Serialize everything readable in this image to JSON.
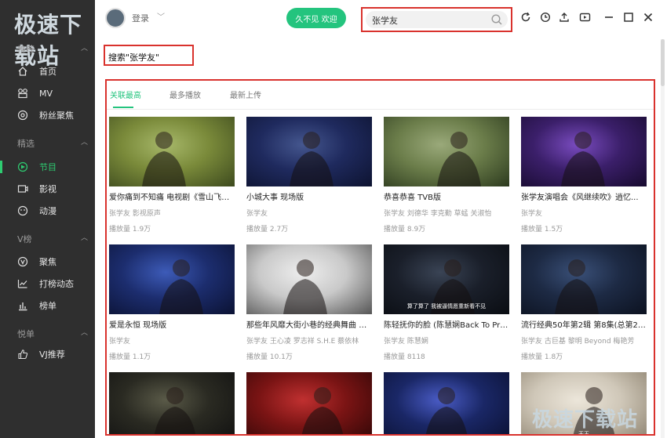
{
  "brand": {
    "watermark_top": "极速下载站",
    "watermark_bottom": "极速下载站"
  },
  "header": {
    "login_label": "登录",
    "promo_label": "久不见 欢迎",
    "search_value": "张学友",
    "accent": "#24c47e",
    "highlight": "#d9322d"
  },
  "sidebar": {
    "sections": [
      {
        "title": "推荐",
        "items": [
          "首页",
          "MV",
          "粉丝聚焦"
        ]
      },
      {
        "title": "精选",
        "items": [
          "节目",
          "影视",
          "动漫"
        ]
      },
      {
        "title": "V榜",
        "items": [
          "聚焦",
          "打榜动态",
          "榜单"
        ]
      },
      {
        "title": "悦单",
        "items": [
          "VJ推荐"
        ]
      }
    ],
    "active_item": "节目"
  },
  "main": {
    "query_label": "搜索\"张学友\"",
    "tabs": [
      {
        "label": "关联最高",
        "active": true
      },
      {
        "label": "最多播放",
        "active": false
      },
      {
        "label": "最新上传",
        "active": false
      }
    ],
    "cards": [
      {
        "title": "爱你痛到不知痛 电视剧《雪山飞狐...",
        "artist": "张学友 影视原声",
        "plays": "播放量 1.9万",
        "thumb_colors": [
          "#7a8a3a",
          "#a7b86a",
          "#3d4a1e"
        ],
        "caption": ""
      },
      {
        "title": "小城大事 现场版",
        "artist": "张学友",
        "plays": "播放量 2.7万",
        "thumb_colors": [
          "#1f2a5e",
          "#45578f",
          "#0d1330"
        ],
        "caption": ""
      },
      {
        "title": "恭喜恭喜 TVB版",
        "artist": "张学友 刘德华 李克勤 草蜢 关淑怡",
        "plays": "播放量 8.9万",
        "thumb_colors": [
          "#6b7d4a",
          "#9aa97a",
          "#2c3a1e"
        ],
        "caption": ""
      },
      {
        "title": "张学友演唱会《风继续吹》逍忆...",
        "artist": "张学友",
        "plays": "播放量 1.5万",
        "thumb_colors": [
          "#3b1f6a",
          "#7a4cc0",
          "#170a2e"
        ],
        "caption": ""
      },
      {
        "title": "爱是永恒 现场版",
        "artist": "张学友",
        "plays": "播放量 1.1万",
        "thumb_colors": [
          "#1c2d6e",
          "#3d5bb8",
          "#0b1233"
        ],
        "caption": ""
      },
      {
        "title": "那些年风靡大街小巷的经典舞曲 第...",
        "artist": "张学友 王心凌 罗志祥 S.H.E 蔡依林",
        "plays": "播放量 10.1万",
        "thumb_colors": [
          "#c9c9c9",
          "#eeeeee",
          "#555555"
        ],
        "caption": ""
      },
      {
        "title": "陈轻抚你的脸 (陈慧娴Back To Pri...",
        "artist": "张学友 陈慧娴",
        "plays": "播放量 8118",
        "thumb_colors": [
          "#1a1f2a",
          "#3a4455",
          "#0a0d12"
        ],
        "caption": "算了算了 我被逼情愿重新看不见"
      },
      {
        "title": "流行经典50年第2辑 第8集(总第27...",
        "artist": "张学友 古巨基 黎明 Beyond 梅艳芳",
        "plays": "播放量 1.8万",
        "thumb_colors": [
          "#1d2a44",
          "#3a5078",
          "#0c1220"
        ],
        "caption": ""
      },
      {
        "title": "",
        "artist": "",
        "plays": "",
        "thumb_colors": [
          "#2a2a22",
          "#5a5a48",
          "#101010"
        ],
        "caption": ""
      },
      {
        "title": "",
        "artist": "",
        "plays": "",
        "thumb_colors": [
          "#7a1414",
          "#c03030",
          "#2e0606"
        ],
        "caption": ""
      },
      {
        "title": "",
        "artist": "",
        "plays": "",
        "thumb_colors": [
          "#1a2766",
          "#4a5cc6",
          "#0a1030"
        ],
        "caption": ""
      },
      {
        "title": "",
        "artist": "",
        "plays": "",
        "thumb_colors": [
          "#cfc7b8",
          "#ece6da",
          "#8a7f6c"
        ],
        "caption": "天王"
      }
    ]
  }
}
